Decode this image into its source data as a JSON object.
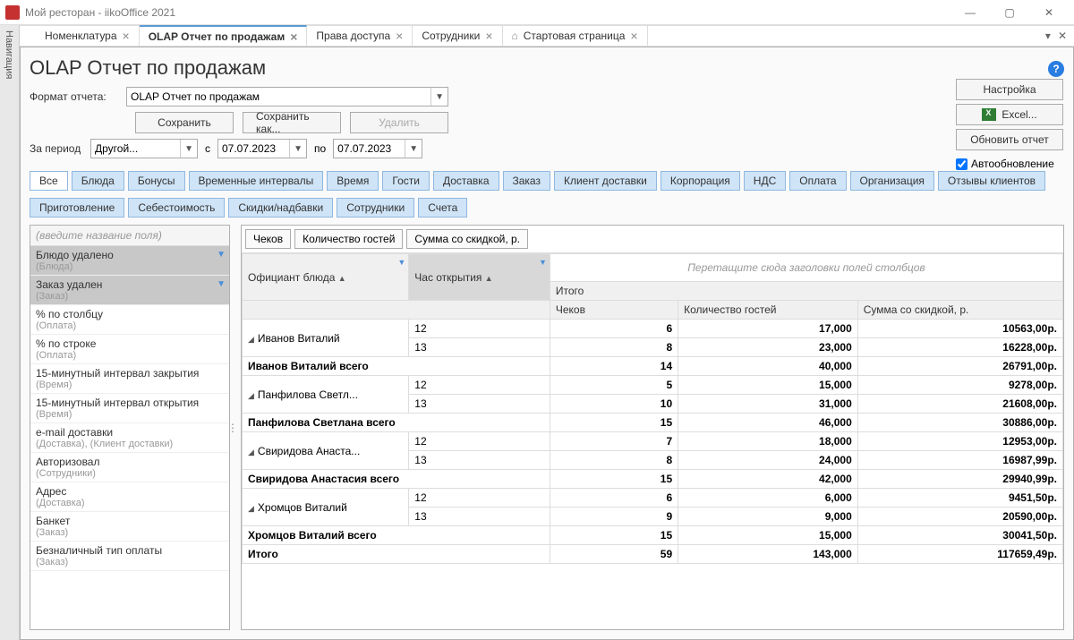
{
  "window": {
    "title": "Мой ресторан - iikoOffice 2021"
  },
  "nav_rail": "Навигация",
  "tabs": [
    {
      "label": "Номенклатура",
      "active": false,
      "icon": null
    },
    {
      "label": "OLAP Отчет по продажам",
      "active": true,
      "icon": null
    },
    {
      "label": "Права доступа",
      "active": false,
      "icon": null
    },
    {
      "label": "Сотрудники",
      "active": false,
      "icon": null
    },
    {
      "label": "Стартовая страница",
      "active": false,
      "icon": "home"
    }
  ],
  "page": {
    "title": "OLAP Отчет по продажам",
    "help": "?",
    "format_label": "Формат отчета:",
    "format_value": "OLAP Отчет по продажам",
    "btn_save": "Сохранить",
    "btn_save_as": "Сохранить как...",
    "btn_delete": "Удалить",
    "period_label": "За период",
    "period_value": "Другой...",
    "from_label": "с",
    "from_value": "07.07.2023",
    "to_label": "по",
    "to_value": "07.07.2023",
    "btn_settings": "Настройка",
    "btn_excel": "Excel...",
    "btn_refresh": "Обновить отчет",
    "chk_auto": "Автообновление"
  },
  "tags_row1": [
    "Все",
    "Блюда",
    "Бонусы",
    "Временные интервалы",
    "Время",
    "Гости",
    "Доставка",
    "Заказ",
    "Клиент доставки",
    "Корпорация",
    "НДС",
    "Оплата",
    "Организация",
    "Отзывы клиентов"
  ],
  "tags_row1_sel": [
    1,
    2,
    3,
    4,
    5,
    6,
    7,
    8,
    9,
    10,
    11,
    12,
    13
  ],
  "tags_row2": [
    "Приготовление",
    "Себестоимость",
    "Скидки/надбавки",
    "Сотрудники",
    "Счета"
  ],
  "field_placeholder": "(введите название поля)",
  "fields": [
    {
      "name": "Блюдо удалено",
      "cat": "(Блюда)",
      "pin": true,
      "sel": true
    },
    {
      "name": "Заказ удален",
      "cat": "(Заказ)",
      "pin": true,
      "sel": true
    },
    {
      "name": "% по столбцу",
      "cat": "(Оплата)",
      "pin": false,
      "sel": false
    },
    {
      "name": "% по строке",
      "cat": "(Оплата)",
      "pin": false,
      "sel": false
    },
    {
      "name": "15-минутный интервал закрытия",
      "cat": "(Время)",
      "pin": false,
      "sel": false
    },
    {
      "name": "15-минутный интервал открытия",
      "cat": "(Время)",
      "pin": false,
      "sel": false
    },
    {
      "name": "e-mail доставки",
      "cat": "(Доставка), (Клиент доставки)",
      "pin": false,
      "sel": false
    },
    {
      "name": "Авторизовал",
      "cat": "(Сотрудники)",
      "pin": false,
      "sel": false
    },
    {
      "name": "Адрес",
      "cat": "(Доставка)",
      "pin": false,
      "sel": false
    },
    {
      "name": "Банкет",
      "cat": "(Заказ)",
      "pin": false,
      "sel": false
    },
    {
      "name": "Безналичный тип оплаты",
      "cat": "(Заказ)",
      "pin": false,
      "sel": false
    }
  ],
  "chips": [
    "Чеков",
    "Количество гостей",
    "Сумма со скидкой, р."
  ],
  "dropzone": "Перетащите сюда заголовки полей столбцов",
  "grid": {
    "col_waiter": "Официант блюда",
    "col_hour": "Час открытия",
    "col_total_top": "Итого",
    "col_checks": "Чеков",
    "col_guests": "Количество гостей",
    "col_sum": "Сумма со скидкой, р.",
    "groups": [
      {
        "waiter": "Иванов Виталий",
        "total_label": "Иванов Виталий всего",
        "rows": [
          {
            "hour": "12",
            "checks": "6",
            "guests": "17,000",
            "sum": "10563,00р."
          },
          {
            "hour": "13",
            "checks": "8",
            "guests": "23,000",
            "sum": "16228,00р."
          }
        ],
        "total": {
          "checks": "14",
          "guests": "40,000",
          "sum": "26791,00р."
        }
      },
      {
        "waiter": "Панфилова Светл...",
        "total_label": "Панфилова Светлана всего",
        "rows": [
          {
            "hour": "12",
            "checks": "5",
            "guests": "15,000",
            "sum": "9278,00р."
          },
          {
            "hour": "13",
            "checks": "10",
            "guests": "31,000",
            "sum": "21608,00р."
          }
        ],
        "total": {
          "checks": "15",
          "guests": "46,000",
          "sum": "30886,00р."
        }
      },
      {
        "waiter": "Свиридова Анаста...",
        "total_label": "Свиридова Анастасия всего",
        "rows": [
          {
            "hour": "12",
            "checks": "7",
            "guests": "18,000",
            "sum": "12953,00р."
          },
          {
            "hour": "13",
            "checks": "8",
            "guests": "24,000",
            "sum": "16987,99р."
          }
        ],
        "total": {
          "checks": "15",
          "guests": "42,000",
          "sum": "29940,99р."
        }
      },
      {
        "waiter": "Хромцов Виталий",
        "total_label": "Хромцов Виталий всего",
        "rows": [
          {
            "hour": "12",
            "checks": "6",
            "guests": "6,000",
            "sum": "9451,50р."
          },
          {
            "hour": "13",
            "checks": "9",
            "guests": "9,000",
            "sum": "20590,00р."
          }
        ],
        "total": {
          "checks": "15",
          "guests": "15,000",
          "sum": "30041,50р."
        }
      }
    ],
    "grand_label": "Итого",
    "grand": {
      "checks": "59",
      "guests": "143,000",
      "sum": "117659,49р."
    }
  }
}
